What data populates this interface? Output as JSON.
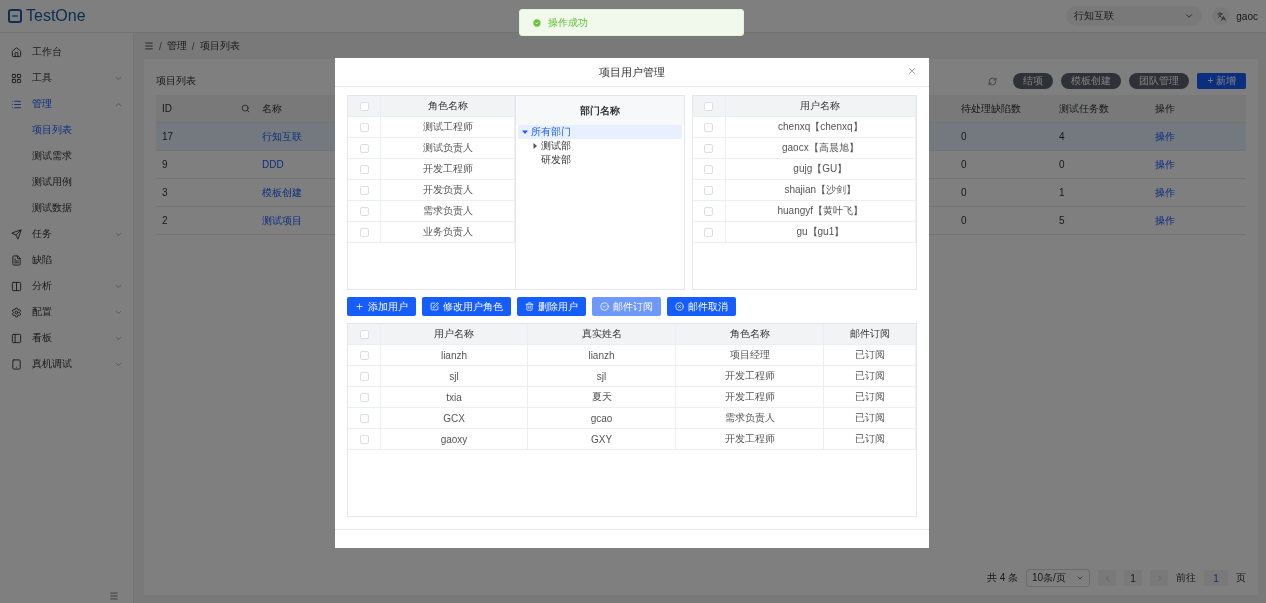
{
  "header": {
    "logo": "TestOne",
    "project_select": "行知互联",
    "user": "gaoc"
  },
  "sidebar": {
    "items": [
      {
        "label": "工作台",
        "selected": false
      },
      {
        "label": "工具",
        "selected": false,
        "expanded": false
      },
      {
        "label": "管理",
        "selected": true,
        "expanded": true,
        "children": [
          {
            "label": "项目列表",
            "selected": true
          },
          {
            "label": "测试需求",
            "selected": false
          },
          {
            "label": "测试用例",
            "selected": false
          },
          {
            "label": "测试数据",
            "selected": false
          }
        ]
      },
      {
        "label": "任务",
        "selected": false,
        "expanded": false
      },
      {
        "label": "缺陷",
        "selected": false
      },
      {
        "label": "分析",
        "selected": false,
        "expanded": false
      },
      {
        "label": "配置",
        "selected": false,
        "expanded": false
      },
      {
        "label": "看板",
        "selected": false,
        "expanded": false
      },
      {
        "label": "真机调试",
        "selected": false,
        "expanded": false
      }
    ]
  },
  "breadcrumb": {
    "separator": "/",
    "items": [
      "管理",
      "项目列表"
    ]
  },
  "card": {
    "title": "项目列表",
    "buttons": [
      {
        "label": "结项",
        "kind": "default"
      },
      {
        "label": "模板创建",
        "kind": "default"
      },
      {
        "label": "团队管理",
        "kind": "default"
      },
      {
        "label": "+ 新增",
        "kind": "primary"
      }
    ],
    "table": {
      "columns": [
        "ID",
        "名称",
        "待处理缺陷数",
        "测试任务数",
        "操作"
      ],
      "rows": [
        {
          "id": "17",
          "name": "行知互联",
          "pending": "0",
          "tasks": "4",
          "action": "操作",
          "selected": true
        },
        {
          "id": "9",
          "name": "DDD",
          "pending": "0",
          "tasks": "0",
          "action": "操作",
          "selected": false
        },
        {
          "id": "3",
          "name": "模板创建",
          "pending": "0",
          "tasks": "1",
          "action": "操作",
          "selected": false
        },
        {
          "id": "2",
          "name": "测试项目",
          "pending": "0",
          "tasks": "5",
          "action": "操作",
          "selected": false
        }
      ]
    },
    "pagination": {
      "total": "共 4 条",
      "page_size": "10条/页",
      "current": "1",
      "goto_label": "前往",
      "goto_value": "1",
      "goto_suffix": "页"
    }
  },
  "toast": {
    "message": "操作成功"
  },
  "dialog": {
    "title": "项目用户管理",
    "roles": {
      "header": "角色名称",
      "all_checked": false,
      "rows": [
        {
          "name": "测试工程师",
          "checked": false
        },
        {
          "name": "测试负责人",
          "checked": false
        },
        {
          "name": "开发工程师",
          "checked": false
        },
        {
          "name": "开发负责人",
          "checked": false
        },
        {
          "name": "需求负责人",
          "checked": false
        },
        {
          "name": "业务负责人",
          "checked": false
        }
      ]
    },
    "departments": {
      "header": "部门名称",
      "tree": [
        {
          "label": "所有部门",
          "selected": true,
          "expanded": true,
          "children": [
            {
              "label": "测试部",
              "selected": false,
              "expanded": false
            },
            {
              "label": "研发部",
              "selected": false
            }
          ]
        }
      ]
    },
    "users": {
      "header": "用户名称",
      "all_checked": false,
      "rows": [
        {
          "name": "chenxq【chenxq】",
          "checked": false
        },
        {
          "name": "gaocx【高晨旭】",
          "checked": false
        },
        {
          "name": "gujg【GU】",
          "checked": false
        },
        {
          "name": "shajian【沙剑】",
          "checked": false
        },
        {
          "name": "huangyf【黄叶飞】",
          "checked": false
        },
        {
          "name": "gu【gu1】",
          "checked": false
        }
      ]
    },
    "buttons": [
      {
        "label": "添加用户",
        "disabled": false
      },
      {
        "label": "修改用户角色",
        "disabled": false
      },
      {
        "label": "删除用户",
        "disabled": false
      },
      {
        "label": "邮件订阅",
        "disabled": true
      },
      {
        "label": "邮件取消",
        "disabled": false
      }
    ],
    "members": {
      "columns": [
        "用户名称",
        "真实姓名",
        "角色名称",
        "邮件订阅"
      ],
      "all_checked": false,
      "rows": [
        {
          "cells": [
            "lianzh",
            "lianzh",
            "项目经理",
            "已订阅"
          ],
          "checked": false
        },
        {
          "cells": [
            "sjl",
            "sjl",
            "开发工程师",
            "已订阅"
          ],
          "checked": false
        },
        {
          "cells": [
            "txia",
            "夏天",
            "开发工程师",
            "已订阅"
          ],
          "checked": false
        },
        {
          "cells": [
            "GCX",
            "gcao",
            "需求负责人",
            "已订阅"
          ],
          "checked": false
        },
        {
          "cells": [
            "gaoxy",
            "GXY",
            "开发工程师",
            "已订阅"
          ],
          "checked": false
        }
      ]
    }
  }
}
